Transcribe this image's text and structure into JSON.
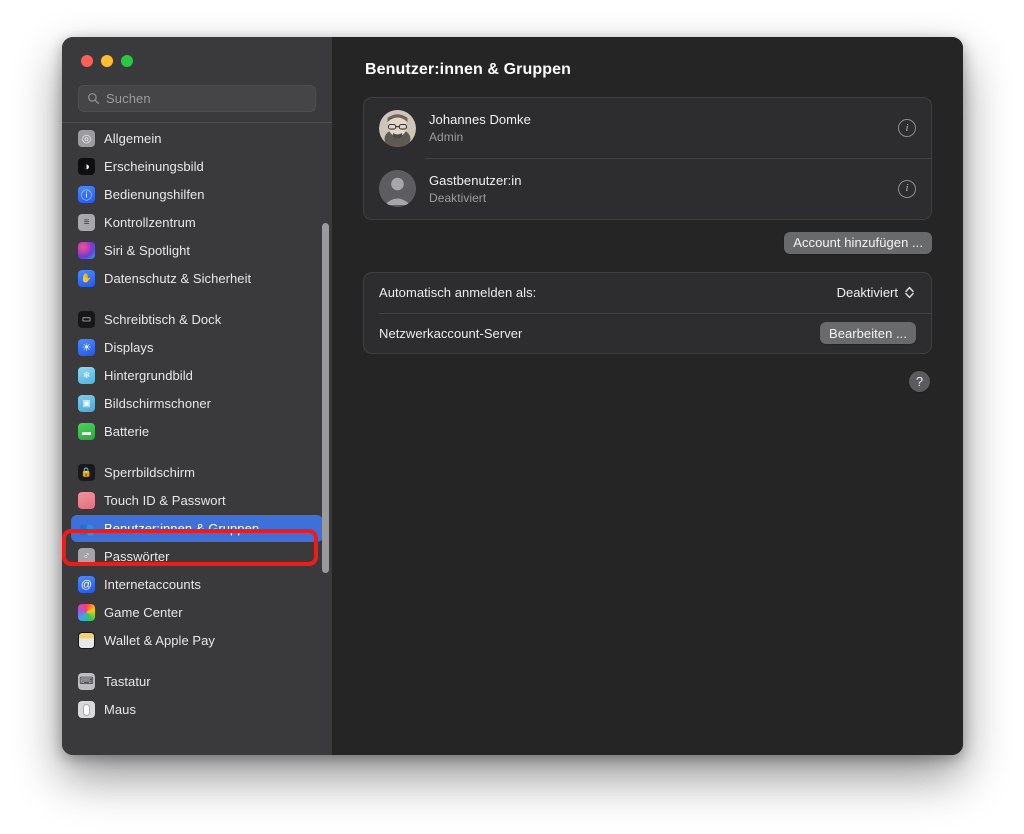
{
  "window": {
    "traffic_lights": [
      {
        "name": "close",
        "color": "#ff5f57"
      },
      {
        "name": "minimize",
        "color": "#febc2e"
      },
      {
        "name": "zoom",
        "color": "#28c840"
      }
    ]
  },
  "sidebar": {
    "search": {
      "placeholder": "Suchen",
      "value": "",
      "icon": "search-icon"
    },
    "selected": "Benutzer:innen & Gruppen",
    "groups": [
      {
        "items": [
          {
            "label": "Allgemein",
            "icon": "general-icon",
            "icon_bg": "#8e8e93",
            "glyph": "◎"
          },
          {
            "label": "Erscheinungsbild",
            "icon": "appearance-icon",
            "icon_bg": "#111113",
            "glyph": "◑"
          },
          {
            "label": "Bedienungshilfen",
            "icon": "accessibility-icon",
            "icon_bg": "#2f7cf6",
            "glyph": "ⓘ"
          },
          {
            "label": "Kontrollzentrum",
            "icon": "control-center-icon",
            "icon_bg": "#9a9a9f",
            "glyph": "☰"
          },
          {
            "label": "Siri & Spotlight",
            "icon": "siri-icon",
            "icon_bg": "#b3387f",
            "glyph": ""
          },
          {
            "label": "Datenschutz & Sicherheit",
            "icon": "privacy-icon",
            "icon_bg": "#2f7cf6",
            "glyph": "✋"
          }
        ]
      },
      {
        "items": [
          {
            "label": "Schreibtisch & Dock",
            "icon": "desktop-dock-icon",
            "icon_bg": "#17171a",
            "glyph": "▭"
          },
          {
            "label": "Displays",
            "icon": "displays-icon",
            "icon_bg": "#2f6ef6",
            "glyph": "☀"
          },
          {
            "label": "Hintergrundbild",
            "icon": "wallpaper-icon",
            "icon_bg": "#69c3ea",
            "glyph": "❄"
          },
          {
            "label": "Bildschirmschoner",
            "icon": "screensaver-icon",
            "icon_bg": "#5bb8e8",
            "glyph": "▣"
          },
          {
            "label": "Batterie",
            "icon": "battery-icon",
            "icon_bg": "#37c14a",
            "glyph": "▬"
          }
        ]
      },
      {
        "items": [
          {
            "label": "Sperrbildschirm",
            "icon": "lock-screen-icon",
            "icon_bg": "#19191c",
            "glyph": "🔒"
          },
          {
            "label": "Touch ID & Passwort",
            "icon": "touch-id-icon",
            "icon_bg": "#e9808c",
            "glyph": "◉"
          },
          {
            "label": "Benutzer:innen & Gruppen",
            "icon": "users-groups-icon",
            "icon_bg": "#3f6fd8",
            "glyph": "👥",
            "selected": true
          },
          {
            "label": "Passwörter",
            "icon": "passwords-icon",
            "icon_bg": "#9a9a9f",
            "glyph": "🗝"
          },
          {
            "label": "Internetaccounts",
            "icon": "internet-accounts-icon",
            "icon_bg": "#2f6ef6",
            "glyph": "@"
          },
          {
            "label": "Game Center",
            "icon": "game-center-icon",
            "icon_bg": "#f2f2f4",
            "glyph": ""
          },
          {
            "label": "Wallet & Apple Pay",
            "icon": "wallet-icon",
            "icon_bg": "#1b1b1e",
            "glyph": "▤"
          }
        ]
      },
      {
        "items": [
          {
            "label": "Tastatur",
            "icon": "keyboard-icon",
            "icon_bg": "#9a9a9f",
            "glyph": "⌨"
          },
          {
            "label": "Maus",
            "icon": "mouse-icon",
            "icon_bg": "#d6d6da",
            "glyph": ""
          }
        ]
      }
    ]
  },
  "main": {
    "title": "Benutzer:innen & Gruppen",
    "users": [
      {
        "name": "Johannes Domke",
        "role": "Admin",
        "avatar": "photo-avatar",
        "info": "info-button"
      },
      {
        "name": "Gastbenutzer:in",
        "role": "Deaktiviert",
        "avatar": "placeholder-avatar",
        "info": "info-button"
      }
    ],
    "add_account_label": "Account hinzufügen ...",
    "settings": [
      {
        "label": "Automatisch anmelden als:",
        "control": "popup",
        "value": "Deaktiviert"
      },
      {
        "label": "Netzwerkaccount-Server",
        "control": "button",
        "value": "Bearbeiten ..."
      }
    ],
    "help_label": "?"
  },
  "annotation": {
    "type": "highlight-rectangle",
    "color": "#ee1b1b",
    "target": "Benutzer:innen & Gruppen"
  }
}
